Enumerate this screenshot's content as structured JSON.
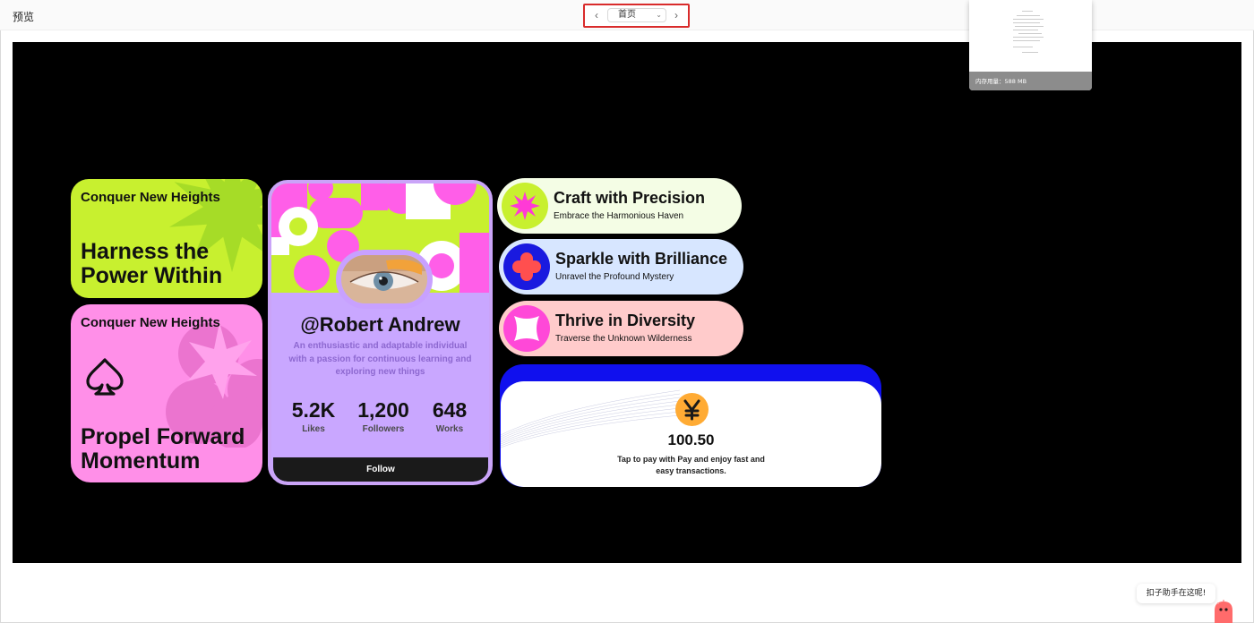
{
  "topbar": {
    "title": "预览",
    "pager": {
      "prev_icon": "chevron-left-icon",
      "selected": "首页",
      "next_icon": "chevron-right-icon"
    }
  },
  "minimap": {
    "memory_label": "内存用量：588 MB"
  },
  "cards": {
    "green": {
      "kicker": "Conquer New Heights",
      "line1": "Harness the",
      "line2": "Power Within",
      "color": "#c8f02f"
    },
    "pink": {
      "kicker": "Conquer New Heights",
      "line1": "Propel Forward",
      "line2": "Momentum",
      "icon": "spade-icon",
      "color": "#ff8fe8"
    },
    "profile": {
      "handle": "@Robert Andrew",
      "bio": "An enthusiastic and adaptable individual with a passion for continuous learning and exploring new things",
      "stats": [
        {
          "value": "5.2K",
          "label": "Likes"
        },
        {
          "value": "1,200",
          "label": "Followers"
        },
        {
          "value": "648",
          "label": "Works"
        }
      ],
      "follow_label": "Follow"
    },
    "pills": [
      {
        "title": "Craft with Precision",
        "subtitle": "Embrace the Harmonious Haven",
        "icon": "starburst-icon"
      },
      {
        "title": "Sparkle with Brilliance",
        "subtitle": "Unravel the Profound Mystery",
        "icon": "clover-icon"
      },
      {
        "title": "Thrive in Diversity",
        "subtitle": "Traverse the Unknown Wilderness",
        "icon": "pinwheel-icon"
      }
    ],
    "pay": {
      "amount": "100.50",
      "note": "Tap to pay with Pay and enjoy fast and easy transactions.",
      "icon": "yen-icon"
    }
  },
  "assistant": {
    "bubble": "扣子助手在这呢!"
  },
  "colors": {
    "accent_red": "#d92b2b",
    "pay_blue": "#1010ee",
    "profile_purple": "#c9a7ff"
  }
}
